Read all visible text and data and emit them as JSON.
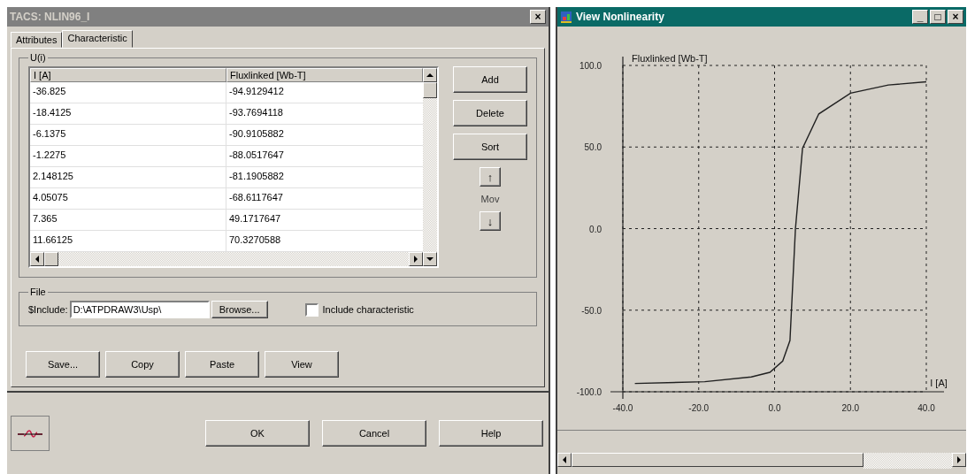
{
  "dialog": {
    "title": "TACS: NLIN96_I",
    "close": "×",
    "tabs": [
      {
        "label": "Attributes",
        "selected": false
      },
      {
        "label": "Characteristic",
        "selected": true
      }
    ],
    "group": "U(i)",
    "table": {
      "columns": [
        "I [A]",
        "Fluxlinked [Wb-T]"
      ],
      "rows": [
        [
          "-36.825",
          "-94.9129412"
        ],
        [
          "-18.4125",
          "-93.7694118"
        ],
        [
          "-6.1375",
          "-90.9105882"
        ],
        [
          "-1.2275",
          "-88.0517647"
        ],
        [
          "2.148125",
          "-81.1905882"
        ],
        [
          "4.05075",
          "-68.6117647"
        ],
        [
          "7.365",
          "49.1717647"
        ],
        [
          "11.66125",
          "70.3270588"
        ]
      ]
    },
    "side_buttons": [
      "Add",
      "Delete",
      "Sort"
    ],
    "move": {
      "up": "↑",
      "label": "Mov",
      "down": "↓"
    },
    "file": {
      "group": "File",
      "label": "$Include:",
      "value": "D:\\ATPDRAW3\\Usp\\",
      "browse": "Browse...",
      "checkbox": {
        "label": "Include characteristic",
        "checked": false
      }
    },
    "actions": [
      "Save...",
      "Copy",
      "Paste",
      "View"
    ],
    "footer_buttons": [
      "OK",
      "Cancel",
      "Help"
    ]
  },
  "viewer": {
    "title": "View Nonlinearity",
    "controls": [
      "_",
      "□",
      "×"
    ],
    "chart_data": {
      "type": "line",
      "xlabel": "I [A]",
      "ylabel": "Fluxlinked [Wb-T]",
      "xlim": [
        -40,
        40
      ],
      "ylim": [
        -100,
        100
      ],
      "xticks": [
        {
          "value": -40,
          "label": "-40.0"
        },
        {
          "value": -20,
          "label": "-20.0"
        },
        {
          "value": 0,
          "label": "0.0"
        },
        {
          "value": 20,
          "label": "20.0"
        },
        {
          "value": 40,
          "label": "40.0"
        }
      ],
      "yticks": [
        {
          "value": -100,
          "label": "-100.0"
        },
        {
          "value": -50,
          "label": "-50.0"
        },
        {
          "value": 0,
          "label": "0.0"
        },
        {
          "value": 50,
          "label": "50.0"
        },
        {
          "value": 100,
          "label": "100.0"
        }
      ],
      "grid": true,
      "x": [
        -36.825,
        -18.4125,
        -6.1375,
        -1.2275,
        2.148125,
        4.05075,
        5.5,
        7.365,
        11.66125,
        20,
        30,
        40
      ],
      "series": [
        {
          "color": "#202020",
          "values": [
            -94.9,
            -93.8,
            -90.9,
            -88.1,
            -81.2,
            -68.6,
            0,
            49.2,
            70.3,
            83,
            88,
            90
          ]
        }
      ]
    }
  }
}
